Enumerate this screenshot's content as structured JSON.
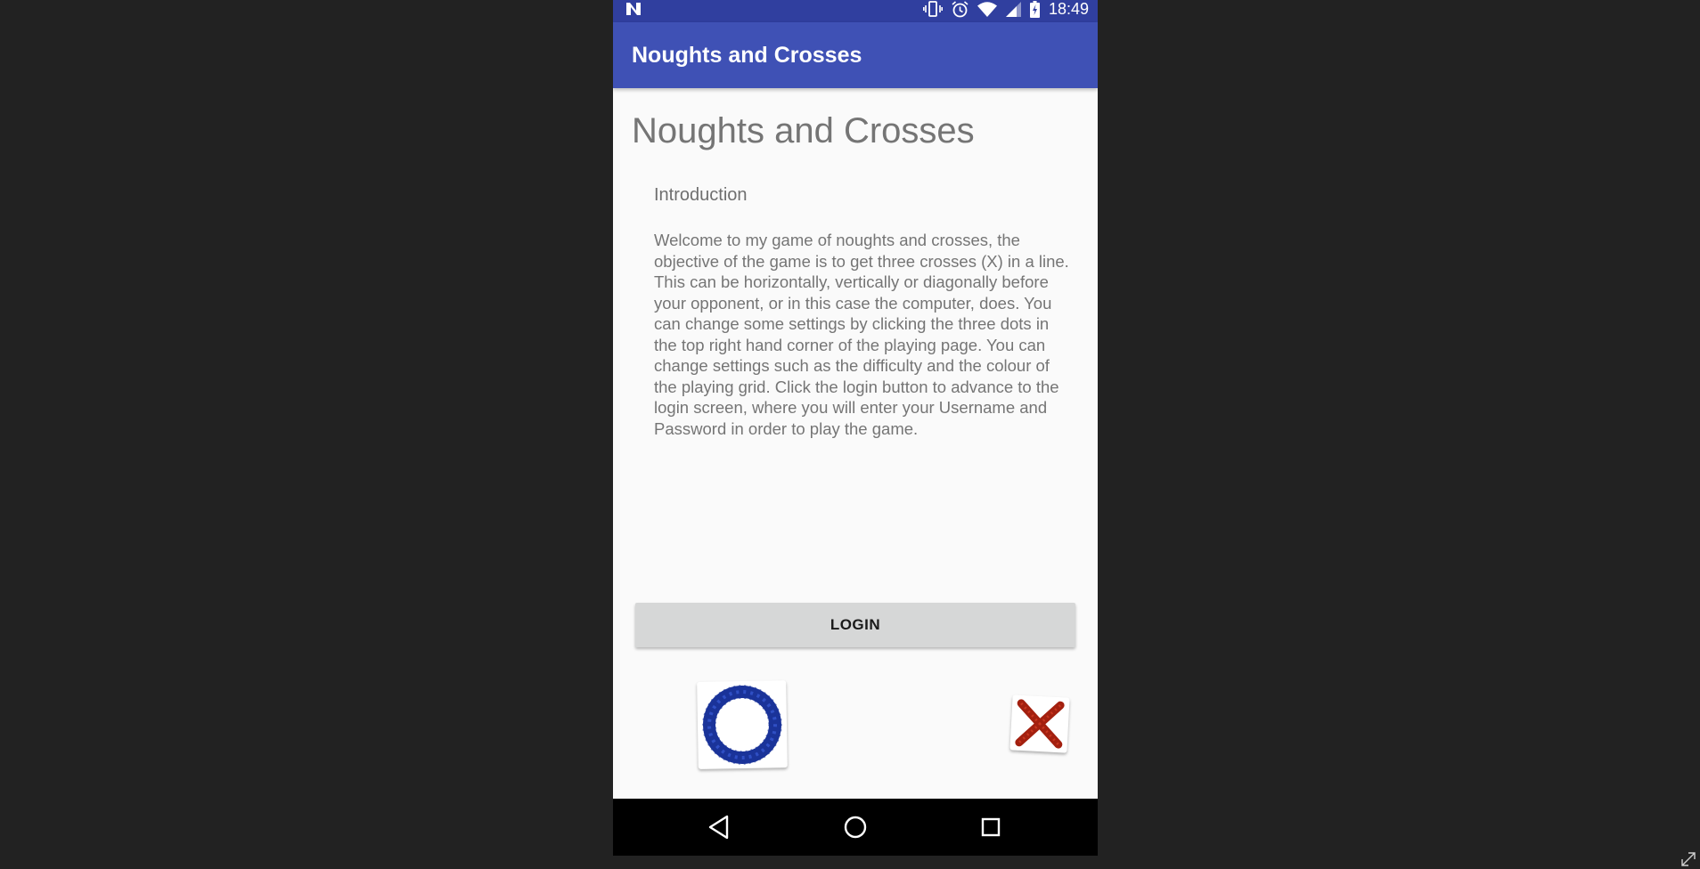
{
  "status_bar": {
    "time": "18:49",
    "icons": [
      "n-logo-icon",
      "vibrate-icon",
      "alarm-icon",
      "wifi-icon",
      "signal-icon",
      "battery-icon"
    ]
  },
  "app_bar": {
    "title": "Noughts and Crosses",
    "color": "#3f51b5"
  },
  "content": {
    "title": "Noughts and Crosses",
    "section_heading": "Introduction",
    "intro_text": "Welcome to my game of noughts and crosses, the objective of the game is to get three crosses (X) in a line. This can be horizontally, vertically or diagonally before your opponent, or in this case the computer, does. You can change some settings by clicking the three dots in the top right hand corner of the playing page. You can change settings such as the difficulty and the colour of the playing grid. Click the login button to advance to the login screen, where you will enter your Username and Password in order to play the game."
  },
  "login_button": {
    "label": "LOGIN"
  },
  "images": {
    "nought": "nought-image",
    "cross": "cross-image",
    "nought_color": "#1a3399",
    "cross_color": "#a3200f"
  },
  "nav_bar": {
    "icons": [
      "back-icon",
      "home-icon",
      "recents-icon"
    ]
  }
}
